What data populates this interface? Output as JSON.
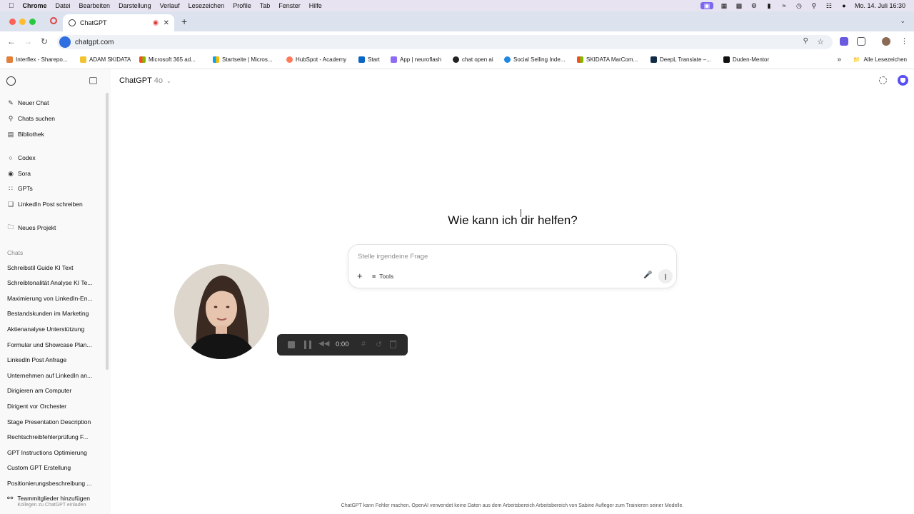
{
  "menubar": {
    "app": "Chrome",
    "items": [
      "Datei",
      "Bearbeiten",
      "Darstellung",
      "Verlauf",
      "Lesezeichen",
      "Profile",
      "Tab",
      "Fenster",
      "Hilfe"
    ],
    "datetime": "Mo. 14. Juli  16:30"
  },
  "tab": {
    "title": "ChatGPT"
  },
  "address": {
    "url": "chatgpt.com"
  },
  "bookmarks": {
    "items": [
      "Interflex - Sharepo...",
      "ADAM SKIDATA",
      "Microsoft 365 ad...",
      "Startseite | Micros...",
      "HubSpot - Academy",
      "Start",
      "App | neuroflash",
      "chat open ai",
      "Social Selling Inde...",
      "SKIDATA MarCom...",
      "DeepL Translate –...",
      "Duden-Mentor"
    ],
    "all_label": "Alle Lesezeichen"
  },
  "sidebar": {
    "top_items": [
      "Neuer Chat",
      "Chats suchen",
      "Bibliothek"
    ],
    "gpt_items": [
      "Codex",
      "Sora",
      "GPTs",
      "LinkedIn Post schreiben"
    ],
    "project_item": "Neues Projekt",
    "chats_label": "Chats",
    "chats": [
      "Schreibstil Guide KI Text",
      "Schreibtonalität Analyse KI Te...",
      "Maximierung von LinkedIn-En...",
      "Bestandskunden im Marketing",
      "Aktienanalyse Unterstützung",
      "Formular und Showcase Plan...",
      "LinkedIn Post Anfrage",
      "Unternehmen auf LinkedIn an...",
      "Dirigieren am Computer",
      "Dirigent vor Orchester",
      "Stage Presentation Description",
      "Rechtschreibfehlerprüfung F...",
      "GPT Instructions Optimierung",
      "Custom GPT Erstellung",
      "Positionierungsbeschreibung ..."
    ],
    "team_title": "Teammitglieder hinzufügen",
    "team_subtitle": "Kollegen zu ChatGPT einladen"
  },
  "header": {
    "model": "ChatGPT",
    "version": "4o"
  },
  "main": {
    "headline": "Wie kann ich dir helfen?",
    "composer_placeholder": "Stelle irgendeine Frage",
    "tools_label": "Tools"
  },
  "recorder": {
    "time": "0:00"
  },
  "footer": "ChatGPT kann Fehler machen. OpenAI verwendet keine Daten aus dem Arbeitsbereich Arbeitsbereich von Sabine Aufleger zum Trainieren seiner Modelle.",
  "colors": {
    "accent": "#5a4ff5",
    "sidebar_bg": "#f9f9f9",
    "recorder_bg": "#2b2b2b"
  }
}
